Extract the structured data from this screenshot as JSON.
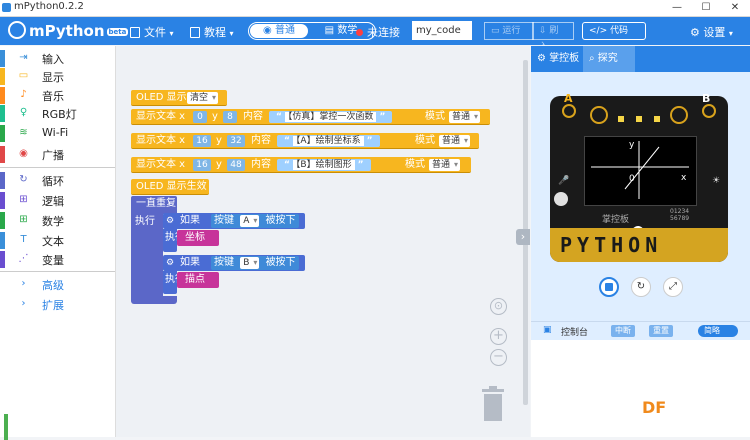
{
  "window": {
    "title": "mPython0.2.2",
    "minimize": "—",
    "maximize": "☐",
    "close": "✕"
  },
  "toolbar": {
    "logo": "mPython",
    "logo_badge": "beta",
    "file": "文件",
    "tutorial": "教程",
    "mode_normal": "普通",
    "mode_code": "数学",
    "status": "未连接",
    "device_name": "my_code",
    "run": "运行",
    "flash": "刷入",
    "code": "代码",
    "settings": "设置"
  },
  "sidebar": {
    "items": [
      {
        "label": "输入",
        "color": "#3a8fd9",
        "icon": "⇥"
      },
      {
        "label": "显示",
        "color": "#f7b61f",
        "icon": "▭"
      },
      {
        "label": "音乐",
        "color": "#ff8a1d",
        "icon": "♪"
      },
      {
        "label": "RGB灯",
        "color": "#1fbf8f",
        "icon": "♀"
      },
      {
        "label": "Wi-Fi",
        "color": "#2aa84a",
        "icon": "≋"
      },
      {
        "label": "广播",
        "color": "#e04848",
        "icon": "◉"
      },
      {
        "label": "循环",
        "color": "#5b67c8",
        "icon": "↻"
      },
      {
        "label": "逻辑",
        "color": "#6a4ed0",
        "icon": "⊞"
      },
      {
        "label": "数学",
        "color": "#2aa84a",
        "icon": "⊞"
      },
      {
        "label": "文本",
        "color": "#3a8fd9",
        "icon": "T"
      },
      {
        "label": "变量",
        "color": "#6a4ed0",
        "icon": "⋰"
      }
    ],
    "advanced": "高级",
    "extensions": "扩展"
  },
  "workspace": {
    "oled_show": "OLED 显示",
    "clear": "清空",
    "show_text": "显示文本 x",
    "y_label": "y",
    "content_label": "内容",
    "mode_label": "模式",
    "mode_value": "普通",
    "quote": "“",
    "quote_end": "”",
    "lines": [
      {
        "x": "0",
        "y": "8",
        "text": "【仿真】掌控一次函数"
      },
      {
        "x": "16",
        "y": "32",
        "text": "【A】绘制坐标系"
      },
      {
        "x": "16",
        "y": "48",
        "text": "【B】绘制图形"
      }
    ],
    "oled_apply": "OLED 显示生效",
    "forever": "一直重复",
    "do": "执行",
    "if": "如果",
    "button": "按键",
    "pressed": "被按下",
    "events": [
      {
        "button": "A",
        "call": "坐标"
      },
      {
        "button": "B",
        "call": "描点"
      }
    ]
  },
  "panel": {
    "tab_board": "掌控板",
    "tab_explore": "探究",
    "board_label_a": "A",
    "board_label_b": "B",
    "screen_y": "y",
    "screen_x": "x",
    "screen_zero": "0",
    "board_brand": "掌控板",
    "board_code_1": "01234",
    "board_code_2": "56789",
    "board_text": "PYTHON",
    "console": "控制台",
    "console_btn1": "中断",
    "console_btn2": "重置",
    "console_toggle": "简略"
  },
  "watermark": "DF",
  "colors": {
    "primary": "#2a82e4",
    "oled": "#f7b61f",
    "loop": "#5b67c8",
    "logic": "#4a6cd4",
    "sub": "#c7349a"
  }
}
